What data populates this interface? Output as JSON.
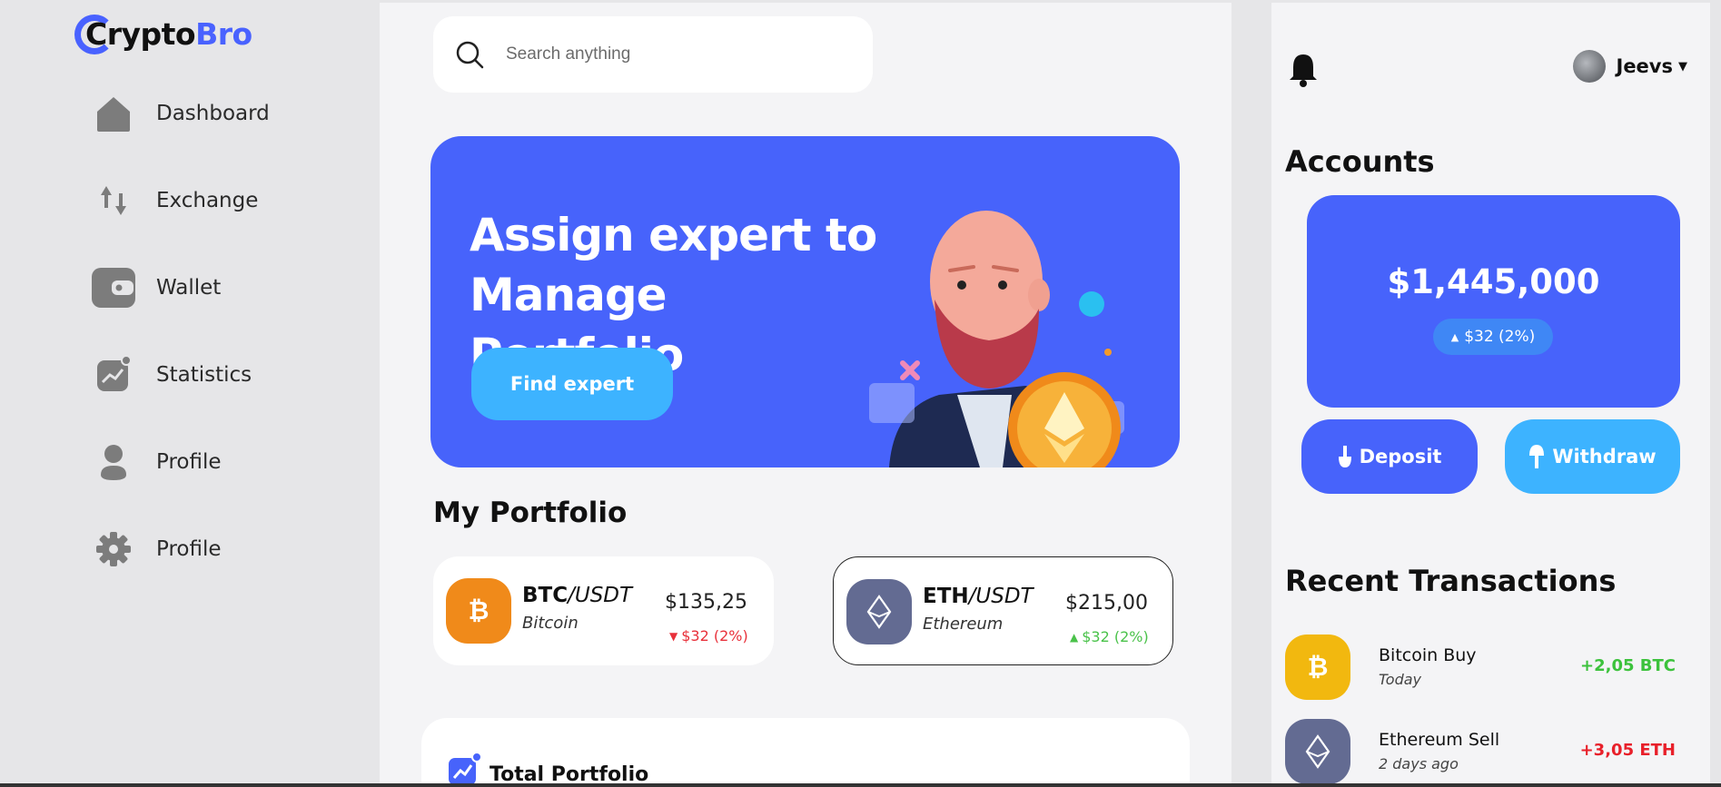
{
  "brand": {
    "part1": "Crypto",
    "part2": "Bro",
    "accent": "#4962ff"
  },
  "sidebar": {
    "items": [
      {
        "label": "Dashboard",
        "icon": "home-icon"
      },
      {
        "label": "Exchange",
        "icon": "exchange-icon"
      },
      {
        "label": "Wallet",
        "icon": "wallet-icon"
      },
      {
        "label": "Statistics",
        "icon": "statistics-icon"
      },
      {
        "label": "Profile",
        "icon": "user-icon"
      },
      {
        "label": "Profile",
        "icon": "gear-icon"
      }
    ]
  },
  "search": {
    "placeholder": "Search anything"
  },
  "banner": {
    "title": "Assign expert to Manage Portfolio",
    "button": "Find expert",
    "bg": "#4763fb",
    "button_bg": "#3db3ff"
  },
  "portfolio": {
    "title": "My Portfolio",
    "cards": [
      {
        "symbol": "BTC",
        "quote": "/USDT",
        "name": "Bitcoin",
        "price": "$135,25",
        "change": "$32 (2%)",
        "direction": "down",
        "coin_color": "#f08a1a"
      },
      {
        "symbol": "ETH",
        "quote": "/USDT",
        "name": "Ethereum",
        "price": "$215,00",
        "change": "$32 (2%)",
        "direction": "up",
        "coin_color": "#636b92"
      }
    ]
  },
  "total_portfolio": {
    "title": "Total Portfolio"
  },
  "user": {
    "name": "Jeevs"
  },
  "accounts": {
    "title": "Accounts",
    "balance": "$1,445,000",
    "change": "$32 (2%)",
    "deposit": "Deposit",
    "withdraw": "Withdraw"
  },
  "recent": {
    "title": "Recent Transactions",
    "items": [
      {
        "name": "Bitcoin Buy",
        "date": "Today",
        "amount": "+2,05 BTC",
        "type": "positive"
      },
      {
        "name": "Ethereum Sell",
        "date": "2 days ago",
        "amount": "+3,05 ETH",
        "type": "negative"
      }
    ]
  },
  "colors": {
    "positive": "#3cc23c",
    "negative": "#e8202a",
    "panel_bg": "#f4f4f6"
  }
}
